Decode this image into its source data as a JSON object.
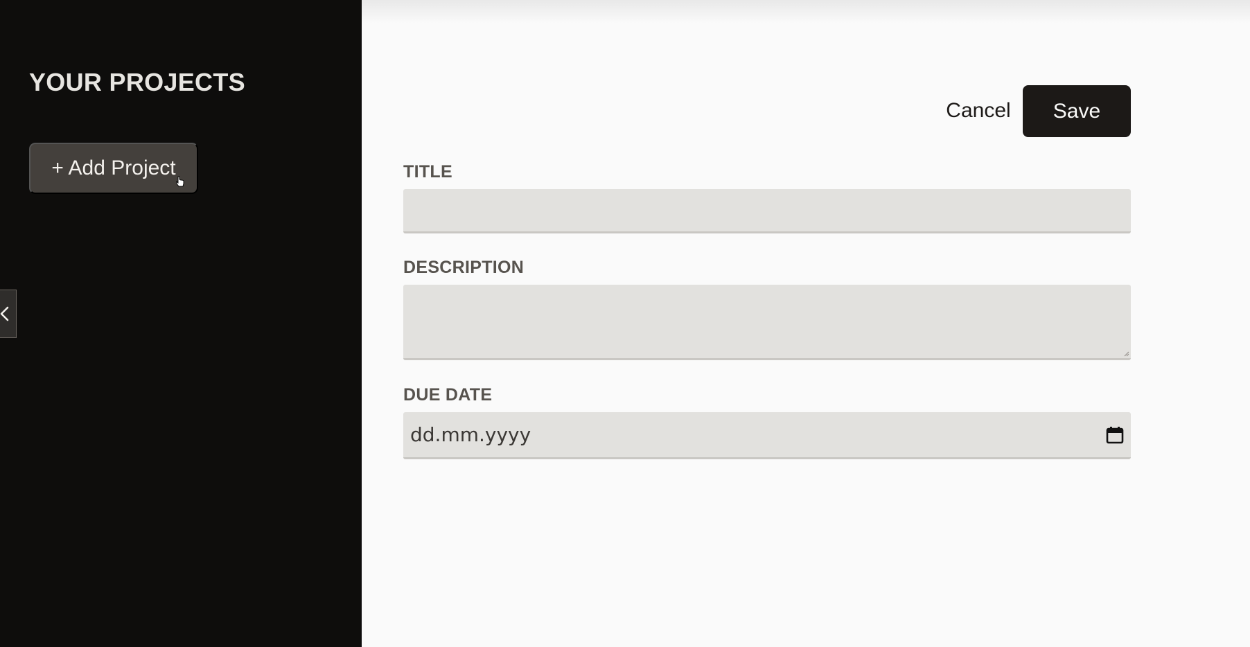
{
  "sidebar": {
    "heading": "YOUR PROJECTS",
    "add_project_label": "+ Add Project",
    "collapse_icon": "chevron-left-icon"
  },
  "form": {
    "cancel_label": "Cancel",
    "save_label": "Save",
    "title_label": "TITLE",
    "title_value": "",
    "description_label": "DESCRIPTION",
    "description_value": "",
    "due_date_label": "DUE DATE",
    "due_date_placeholder": "dd.mm.yyyy",
    "calendar_icon": "calendar-icon"
  },
  "colors": {
    "sidebar_bg": "#0e0d0c",
    "button_bg": "#44403c",
    "save_bg": "#1c1917",
    "input_bg": "#e2e1de",
    "label_color": "#57534e"
  }
}
